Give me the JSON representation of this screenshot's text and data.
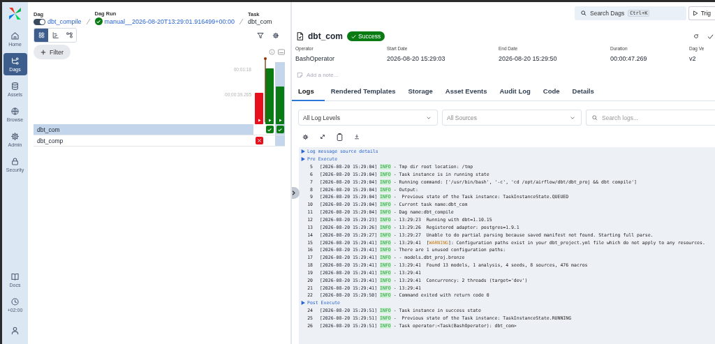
{
  "sidebar": {
    "items": [
      {
        "label": "Home",
        "selected": false
      },
      {
        "label": "Dags",
        "selected": true
      },
      {
        "label": "Assets",
        "selected": false
      },
      {
        "label": "Browse",
        "selected": false
      },
      {
        "label": "Admin",
        "selected": false
      },
      {
        "label": "Security",
        "selected": false
      }
    ],
    "bottom_items": [
      {
        "label": "Docs"
      },
      {
        "label": "+02:00"
      }
    ]
  },
  "breadcrumb": {
    "dag_label": "Dag",
    "dag_enabled": true,
    "dag": "dbt_compile",
    "run_label": "Dag Run",
    "run": "manual__2026-08-20T13:29:01.916499+00:00",
    "task_label": "Task",
    "task": "dbt_com"
  },
  "view_toggle": [
    {
      "selected": true
    },
    {
      "selected": false
    },
    {
      "selected": false
    }
  ],
  "filter_button": "Filter",
  "grid": {
    "duration_ticks": [
      "00:01:18",
      "00:00:39.265"
    ],
    "runs": [
      {
        "color": "#e8101d",
        "selected": false
      },
      {
        "color": "#0a7a12",
        "selected": false
      },
      {
        "color": "#0a7a12",
        "selected": true
      }
    ],
    "tasks": [
      {
        "name": "dbt_com",
        "selected": true,
        "cells": [
          {
            "kind": "empty"
          },
          {
            "kind": "success"
          },
          {
            "kind": "success"
          }
        ]
      },
      {
        "name": "dbt_comp",
        "selected": false,
        "cells": [
          {
            "kind": "failed"
          },
          {
            "kind": "empty"
          },
          {
            "kind": "empty"
          }
        ]
      }
    ]
  },
  "search": {
    "placeholder": "Search Dags",
    "shortcut": "Ctrl+K"
  },
  "trigger_button": "Trig",
  "task": {
    "title": "dbt_com",
    "state_label": "Success",
    "note_placeholder": "Add a note...",
    "fields": [
      {
        "label": "Operator",
        "value": "BashOperator"
      },
      {
        "label": "Start Date",
        "value": "2026-08-20 15:29:03"
      },
      {
        "label": "End Date",
        "value": "2026-08-20 15:29:50"
      },
      {
        "label": "Duration",
        "value": "00:00:47.269"
      },
      {
        "label": "Dag Ve",
        "value": "v2"
      }
    ]
  },
  "tabs": [
    {
      "label": "Logs",
      "selected": true
    },
    {
      "label": "Rendered Templates",
      "selected": false
    },
    {
      "label": "Storage",
      "selected": false
    },
    {
      "label": "Asset Events",
      "selected": false
    },
    {
      "label": "Audit Log",
      "selected": false
    },
    {
      "label": "Code",
      "selected": false
    },
    {
      "label": "Details",
      "selected": false
    }
  ],
  "log_filters": {
    "level": "All Log Levels",
    "source": "All Sources",
    "search_placeholder": "Search logs..."
  },
  "log": [
    {
      "kind": "group",
      "label": "Log message source details"
    },
    {
      "kind": "group",
      "label": "Pre Execute"
    },
    {
      "kind": "line",
      "number": "5",
      "time": "[2026-08-20 15:29:04]",
      "level": "INFO",
      "message": "- Tmp dir root location: /tmp"
    },
    {
      "kind": "line",
      "number": "6",
      "time": "[2026-08-20 15:29:04]",
      "level": "INFO",
      "message": "- Task instance is in running state"
    },
    {
      "kind": "line",
      "number": "7",
      "time": "[2026-08-20 15:29:04]",
      "level": "INFO",
      "message": "- Running command: ['/usr/bin/bash', '-c', 'cd /opt/airflow/dbt/dbt_proj && dbt compile']"
    },
    {
      "kind": "line",
      "number": "8",
      "time": "[2026-08-20 15:29:04]",
      "level": "INFO",
      "message": "- Output:"
    },
    {
      "kind": "line",
      "number": "9",
      "time": "[2026-08-20 15:29:04]",
      "level": "INFO",
      "message": "-  Previous state of the Task instance: TaskInstanceState.QUEUED"
    },
    {
      "kind": "line",
      "number": "10",
      "time": "[2026-08-20 15:29:04]",
      "level": "INFO",
      "message": "- Current task name:dbt_com"
    },
    {
      "kind": "line",
      "number": "11",
      "time": "[2026-08-20 15:29:04]",
      "level": "INFO",
      "message": "- Dag name:dbt_compile"
    },
    {
      "kind": "line",
      "number": "12",
      "time": "[2026-08-20 15:29:23]",
      "level": "INFO",
      "message": "- 13:29:23  Running with dbt=1.10.15"
    },
    {
      "kind": "line",
      "number": "13",
      "time": "[2026-08-20 15:29:26]",
      "level": "INFO",
      "message": "- 13:29:26  Registered adapter: postgres=1.9.1"
    },
    {
      "kind": "line",
      "number": "14",
      "time": "[2026-08-20 15:29:27]",
      "level": "INFO",
      "message": "- 13:29:27  Unable to do partial parsing because saved manifest not found. Starting full parse."
    },
    {
      "kind": "line",
      "number": "15",
      "time": "[2026-08-20 15:29:41]",
      "level": "INFO",
      "message_parts": [
        {
          "text": "- 13:29:41  ["
        },
        {
          "text": "WARNING",
          "kind": "warning"
        },
        {
          "text": "]: Configuration paths exist in your dbt_project.yml file which do not apply to any resources."
        }
      ]
    },
    {
      "kind": "line",
      "number": "16",
      "time": "[2026-08-20 15:29:41]",
      "level": "INFO",
      "message": "- There are 1 unused configuration paths:"
    },
    {
      "kind": "line",
      "number": "17",
      "time": "[2026-08-20 15:29:41]",
      "level": "INFO",
      "message": "- - models.dbt_proj.bronze"
    },
    {
      "kind": "line",
      "number": "18",
      "time": "[2026-08-20 15:29:41]",
      "level": "INFO",
      "message": "- 13:29:41  Found 13 models, 1 analysis, 4 seeds, 8 sources, 476 macros"
    },
    {
      "kind": "line",
      "number": "19",
      "time": "[2026-08-20 15:29:41]",
      "level": "INFO",
      "message": "- 13:29:41"
    },
    {
      "kind": "line",
      "number": "20",
      "time": "[2026-08-20 15:29:41]",
      "level": "INFO",
      "message": "- 13:29:41  Concurrency: 2 threads (target='dev')"
    },
    {
      "kind": "line",
      "number": "21",
      "time": "[2026-08-20 15:29:41]",
      "level": "INFO",
      "message": "- 13:29:41"
    },
    {
      "kind": "line",
      "number": "22",
      "time": "[2026-08-20 15:29:50]",
      "level": "INFO",
      "message": "- Command exited with return code 0"
    },
    {
      "kind": "group",
      "label": "Post Execute"
    },
    {
      "kind": "line",
      "number": "24",
      "time": "[2026-08-20 15:29:51]",
      "level": "INFO",
      "message": "- Task instance in success state"
    },
    {
      "kind": "line",
      "number": "25",
      "time": "[2026-08-20 15:29:51]",
      "level": "INFO",
      "message": "-  Previous state of the Task instance: TaskInstanceState.RUNNING"
    },
    {
      "kind": "line",
      "number": "26",
      "time": "[2026-08-20 15:29:51]",
      "level": "INFO",
      "message": "- Task operator:<Task(BashOperator): dbt_com>"
    }
  ]
}
